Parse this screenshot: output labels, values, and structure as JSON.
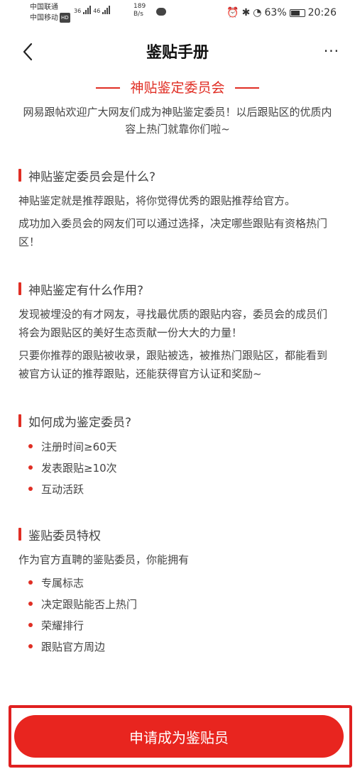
{
  "status_bar": {
    "carrier_1": "中国联通",
    "carrier_2": "中国移动",
    "hd": "HD",
    "net_1": "36",
    "net_2": "46",
    "speed_value": "189",
    "speed_unit": "B/s",
    "battery_text": "63%",
    "time": "20:26"
  },
  "nav": {
    "title": "鉴贴手册",
    "more": "···"
  },
  "committee": {
    "title": "神贴鉴定委员会"
  },
  "intro": "网易跟帖欢迎广大网友们成为神贴鉴定委员！以后跟贴区的优质内容上热门就靠你们啦~",
  "sections": [
    {
      "title": "神贴鉴定委员会是什么?",
      "paragraphs": [
        "神贴鉴定就是推荐跟贴，将你觉得优秀的跟贴推荐给官方。",
        "成功加入委员会的网友们可以通过选择，决定哪些跟贴有资格热门区！"
      ]
    },
    {
      "title": "神贴鉴定有什么作用?",
      "paragraphs": [
        "发现被埋没的有才网友，寻找最优质的跟贴内容，委员会的成员们将会为跟贴区的美好生态贡献一份大大的力量！",
        "只要你推荐的跟贴被收录，跟贴被选，被推热门跟贴区，都能看到被官方认证的推荐跟贴，还能获得官方认证和奖励~"
      ]
    },
    {
      "title": "如何成为鉴定委员?",
      "bullets": [
        "注册时间≥60天",
        "发表跟贴≥10次",
        "互动活跃"
      ]
    },
    {
      "title": "鉴贴委员特权",
      "paragraphs": [
        "作为官方直聘的鉴贴委员，你能拥有"
      ],
      "bullets": [
        "专属标志",
        "决定跟贴能否上热门",
        "荣耀排行",
        "跟贴官方周边"
      ]
    }
  ],
  "apply_button": "申请成为鉴贴员",
  "colors": {
    "accent": "#e02e24",
    "button": "#e8251f"
  }
}
